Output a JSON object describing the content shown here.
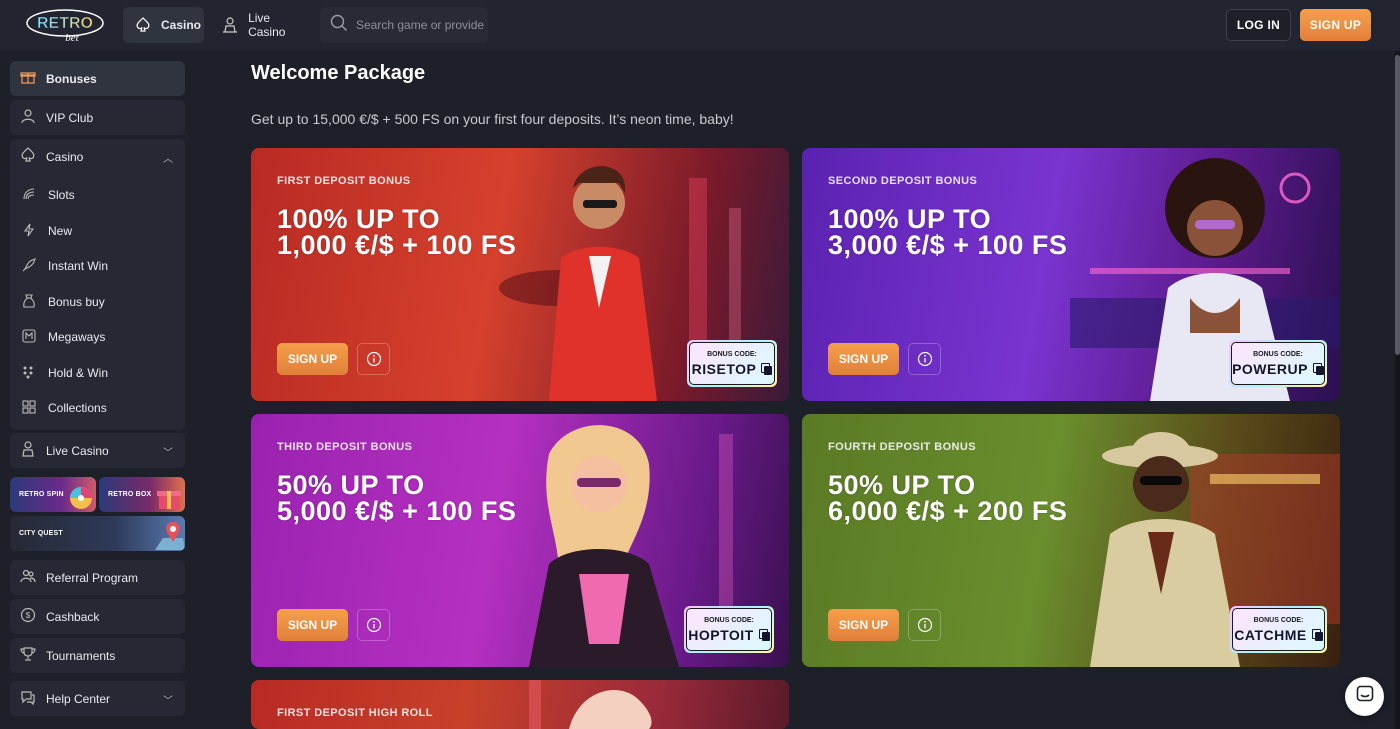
{
  "header": {
    "logo_text": "RETRO bet",
    "tabs": [
      {
        "label": "Casino",
        "icon": "spade-icon",
        "active": true
      },
      {
        "label": "Live Casino",
        "icon": "dealer-icon",
        "active": false
      }
    ],
    "search_placeholder": "Search game or provider",
    "login_label": "LOG IN",
    "signup_label": "SIGN UP"
  },
  "sidebar": {
    "top_items": [
      {
        "label": "Bonuses",
        "icon": "gift-icon"
      },
      {
        "label": "VIP Club",
        "icon": "vip-icon"
      }
    ],
    "casino": {
      "label": "Casino",
      "icon": "spade-icon",
      "expanded": true,
      "items": [
        {
          "label": "Slots",
          "icon": "slots-icon"
        },
        {
          "label": "New",
          "icon": "lightning-icon"
        },
        {
          "label": "Instant Win",
          "icon": "rocket-icon"
        },
        {
          "label": "Bonus buy",
          "icon": "bag-icon"
        },
        {
          "label": "Megaways",
          "icon": "megaways-icon"
        },
        {
          "label": "Hold & Win",
          "icon": "hold-win-icon"
        },
        {
          "label": "Collections",
          "icon": "grid-icon"
        }
      ]
    },
    "live_casino": {
      "label": "Live Casino",
      "icon": "dealer-icon"
    },
    "promos": [
      {
        "label": "RETRO SPIN"
      },
      {
        "label": "RETRO BOX"
      },
      {
        "label": "CITY QUEST"
      }
    ],
    "bottom_items": [
      {
        "label": "Referral Program",
        "icon": "users-icon"
      },
      {
        "label": "Cashback",
        "icon": "cashback-icon"
      },
      {
        "label": "Tournaments",
        "icon": "trophy-icon"
      }
    ],
    "help": {
      "label": "Help Center",
      "icon": "help-icon"
    }
  },
  "main": {
    "title": "Welcome Package",
    "subtitle": "Get up to 15,000 €/$ + 500 FS on your first four deposits. It’s neon time, baby!",
    "cards": [
      {
        "label": "FIRST DEPOSIT BONUS",
        "line1": "100% UP TO",
        "line2": "1,000 €/$ + 100 FS",
        "cta": "SIGN UP",
        "code_label": "BONUS CODE:",
        "code": "RISETOP"
      },
      {
        "label": "SECOND DEPOSIT BONUS",
        "line1": "100% UP TO",
        "line2": "3,000 €/$ + 100 FS",
        "cta": "SIGN UP",
        "code_label": "BONUS CODE:",
        "code": "POWERUP"
      },
      {
        "label": "THIRD DEPOSIT BONUS",
        "line1": "50% UP TO",
        "line2": "5,000 €/$ + 100 FS",
        "cta": "SIGN UP",
        "code_label": "BONUS CODE:",
        "code": "HOPTOIT"
      },
      {
        "label": "FOURTH DEPOSIT BONUS",
        "line1": "50% UP TO",
        "line2": "6,000 €/$ + 200 FS",
        "cta": "SIGN UP",
        "code_label": "BONUS CODE:",
        "code": "CATCHME"
      },
      {
        "label": "FIRST DEPOSIT HIGH ROLL"
      }
    ]
  },
  "colors": {
    "background": "#1d2029",
    "accent_orange": "#f0903f",
    "card1": "#c8322a",
    "card2": "#6a2cc7",
    "card3": "#a228b8",
    "card4": "#5f8a2a"
  }
}
